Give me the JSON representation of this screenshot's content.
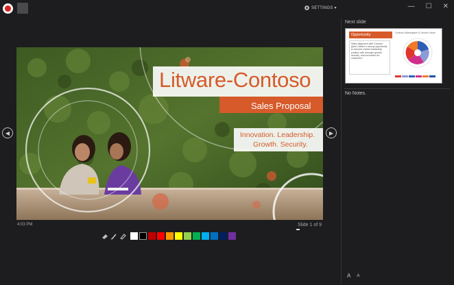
{
  "toolbar": {
    "settings_label": "SETTINGS ▾"
  },
  "window": {
    "minimize": "—",
    "maximize": "☐",
    "close": "✕"
  },
  "slide": {
    "title": "Litware-Contoso",
    "subtitle": "Sales Proposal",
    "tagline_1": "Innovation. Leadership.",
    "tagline_2": "Growth. Security."
  },
  "status": {
    "time": "4:03 PM",
    "slide_counter": "Slide 1 of 9"
  },
  "pen_colors": [
    "#ffffff",
    "#000000",
    "#c00000",
    "#ff0000",
    "#ff9900",
    "#ffff00",
    "#92d050",
    "#00b050",
    "#00b0f0",
    "#0070c0",
    "#002060",
    "#7030a0"
  ],
  "next_slide": {
    "label": "Next slide",
    "header": "Opportunity",
    "body": "Sales alignment with Contoso gives Litware a strong opportunity to become market leadership position with stronger growth, security, and innovation for customers.",
    "chart_title": "Contoso Marketplace & Service Value",
    "legend_colors": [
      "#e0352b",
      "#8b9bd6",
      "#2f5eb5",
      "#d12e8a",
      "#f07a2a",
      "#1a4fa8"
    ]
  },
  "notes": {
    "text": "No Notes."
  },
  "font_controls": {
    "increase": "A",
    "decrease": "A"
  },
  "colors": {
    "background": "#1d1d1f",
    "accent_orange": "#d65a2a",
    "record_red": "#d82020"
  }
}
